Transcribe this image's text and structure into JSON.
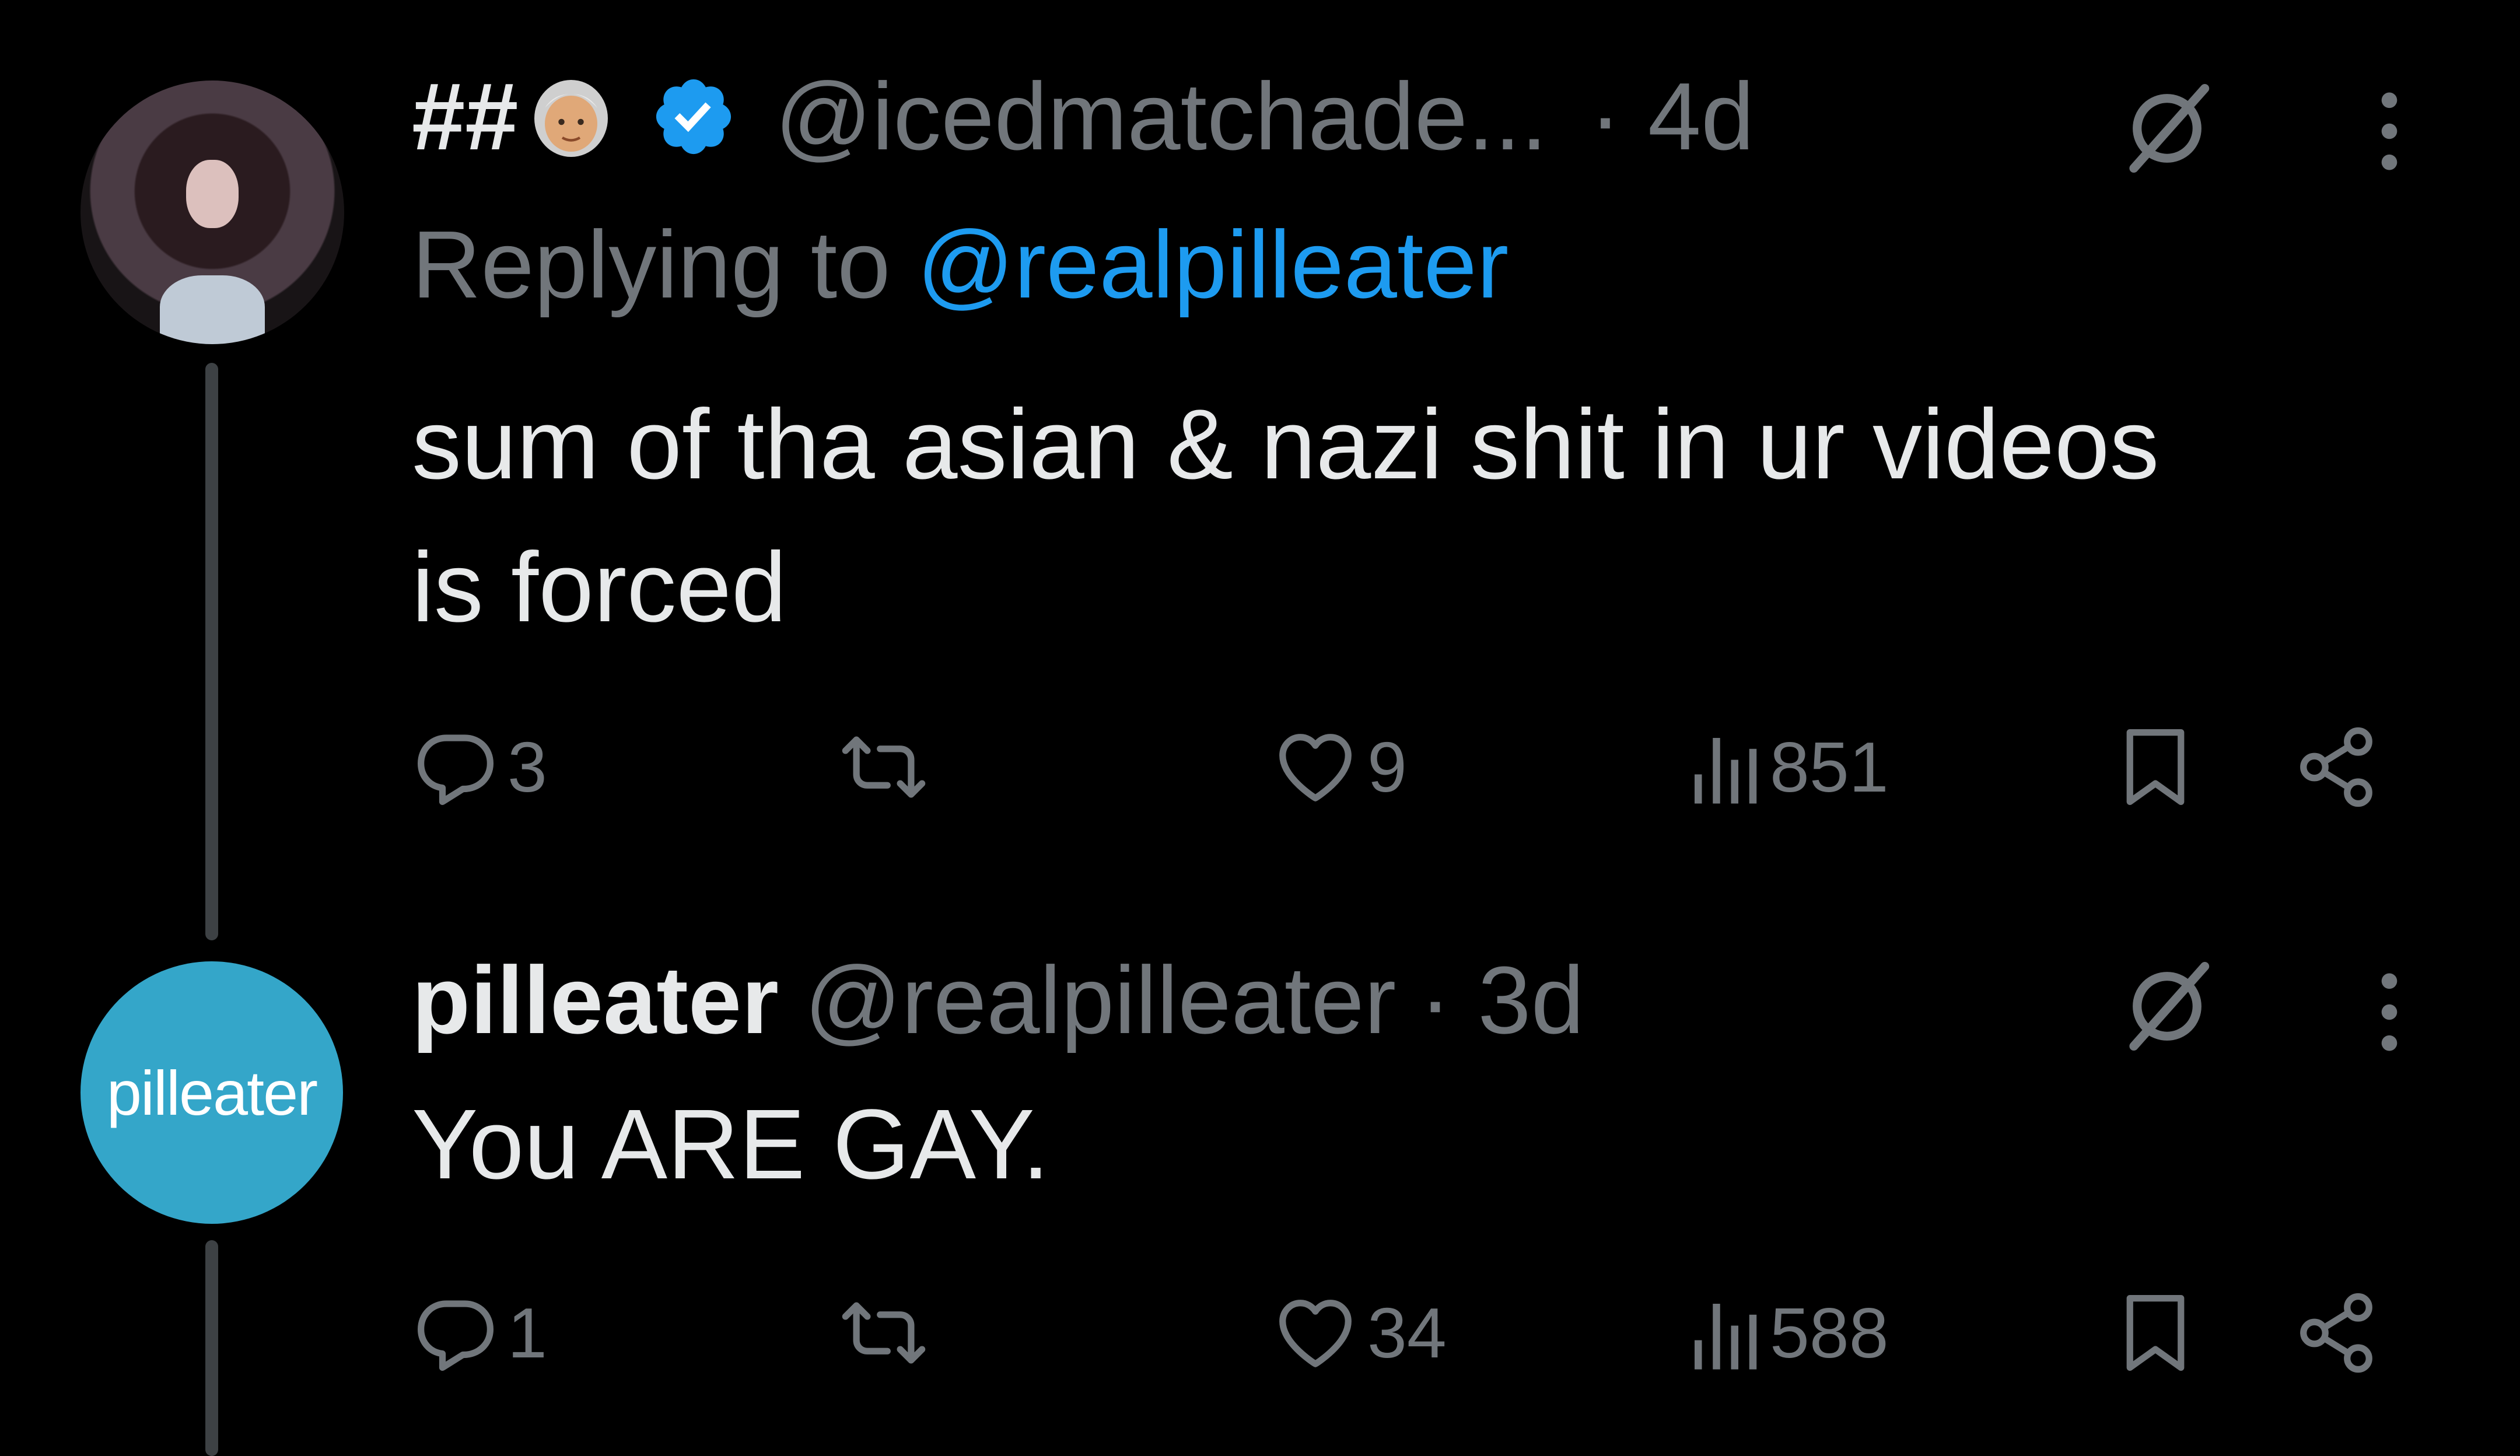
{
  "tweets": [
    {
      "display_name": "##",
      "emoji_icon": "older-woman-emoji-icon",
      "verified": true,
      "handle": "@icedmatchade...",
      "time": "· 4d",
      "replying_prefix": "Replying to",
      "replying_to": "@realpilleater",
      "text_line1": "sum of tha asian & nazi shit in ur videos",
      "text_line2": "is forced",
      "replies": "3",
      "likes": "9",
      "views": "851"
    },
    {
      "display_name": "pilleater",
      "handle": "@realpilleater",
      "time": "· 3d",
      "avatar_text": "pilleater",
      "text_line1": "You ARE GAY.",
      "replies": "1",
      "likes": "34",
      "views": "588"
    }
  ],
  "colors": {
    "background": "#000000",
    "primary_text": "#e7e9ea",
    "secondary_text": "#71767b",
    "link": "#1d9bf0",
    "verified_badge": "#1d9bf0",
    "avatar_bg": "#34a6c9",
    "thread_line": "#3d4144"
  }
}
